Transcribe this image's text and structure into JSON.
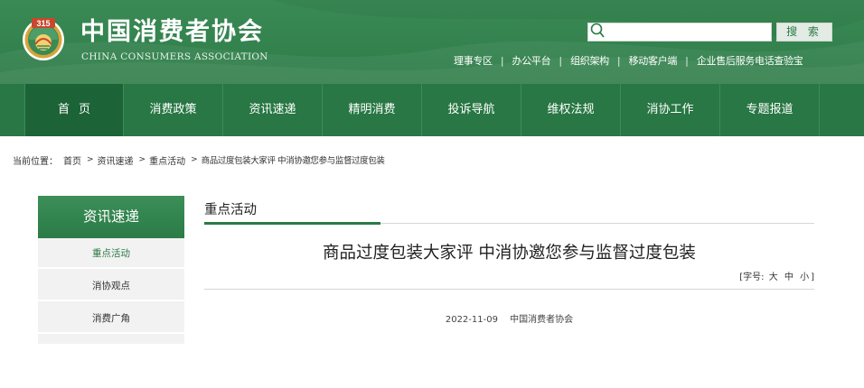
{
  "brand": {
    "name_cn": "中国消费者协会",
    "name_en": "CHINA CONSUMERS ASSOCIATION",
    "logo_text": "315",
    "primary_color": "#2b7a45",
    "nav_color": "#287744",
    "active_nav_color": "#1c6337"
  },
  "search": {
    "value": "",
    "placeholder": "",
    "button_label": "搜 索",
    "icon": "search-icon"
  },
  "quicklinks": [
    "理事专区",
    "办公平台",
    "组织架构",
    "移动客户端",
    "企业售后服务电话查验宝"
  ],
  "quicklink_separator": "|",
  "nav": [
    {
      "label": "首页",
      "active": true
    },
    {
      "label": "消费政策",
      "active": false
    },
    {
      "label": "资讯速递",
      "active": false
    },
    {
      "label": "精明消费",
      "active": false
    },
    {
      "label": "投诉导航",
      "active": false
    },
    {
      "label": "维权法规",
      "active": false
    },
    {
      "label": "消协工作",
      "active": false
    },
    {
      "label": "专题报道",
      "active": false
    }
  ],
  "breadcrumb": {
    "prefix": "当前位置：",
    "items": [
      "首页",
      "资讯速递",
      "重点活动",
      "商品过度包装大家评 中消协邀您参与监督过度包装"
    ],
    "separator": ">"
  },
  "sidebar": {
    "title": "资讯速递",
    "items": [
      {
        "label": "重点活动",
        "active": true
      },
      {
        "label": "消协观点",
        "active": false
      },
      {
        "label": "消费广角",
        "active": false
      }
    ]
  },
  "section": {
    "title": "重点活动"
  },
  "article": {
    "title": "商品过度包装大家评 中消协邀您参与监督过度包装",
    "font_size_label": "[字号:",
    "font_sizes": [
      "大",
      "中",
      "小"
    ],
    "font_size_close": "]",
    "date": "2022-11-09",
    "source": "中国消费者协会"
  }
}
